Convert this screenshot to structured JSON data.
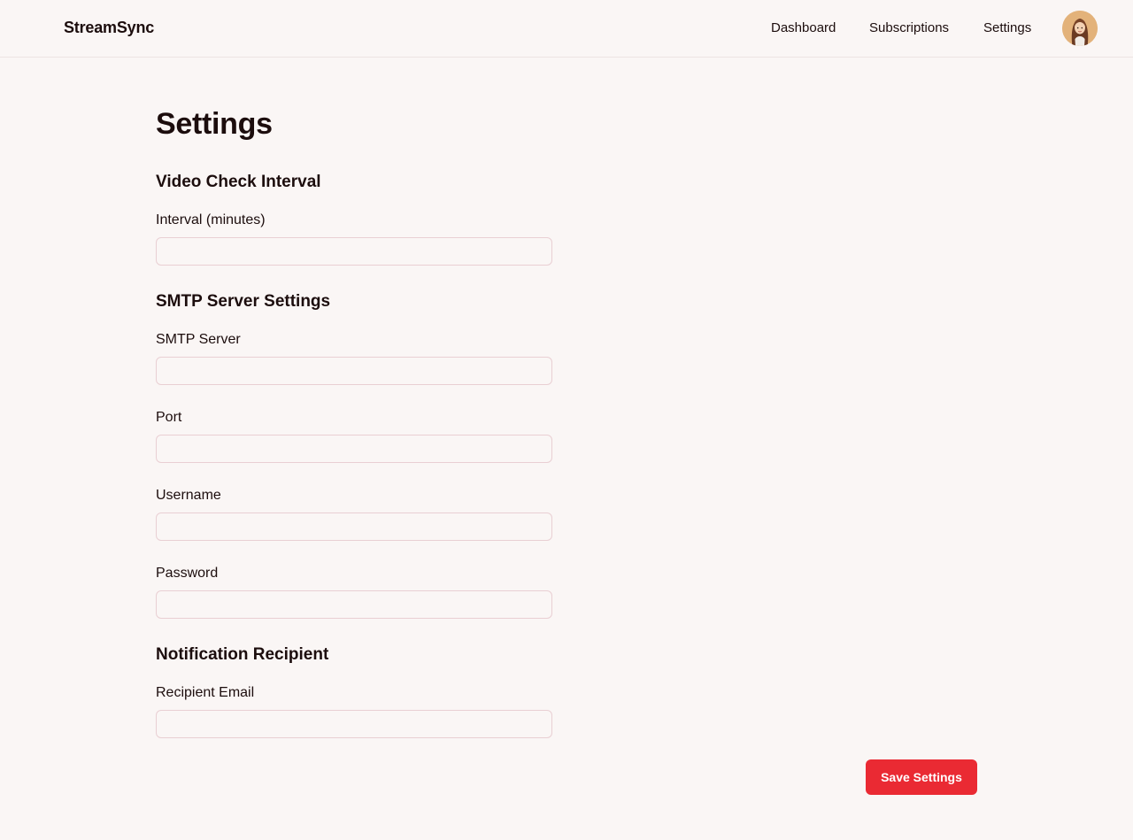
{
  "app": {
    "brand": "StreamSync"
  },
  "nav": {
    "items": [
      {
        "label": "Dashboard"
      },
      {
        "label": "Subscriptions"
      },
      {
        "label": "Settings"
      }
    ],
    "avatar_icon": "user-avatar-icon"
  },
  "page": {
    "title": "Settings"
  },
  "sections": {
    "video_check": {
      "title": "Video Check Interval",
      "interval_label": "Interval (minutes)",
      "interval_value": "",
      "interval_placeholder": ""
    },
    "smtp": {
      "title": "SMTP Server Settings",
      "server_label": "SMTP Server",
      "server_value": "",
      "port_label": "Port",
      "port_value": "",
      "username_label": "Username",
      "username_value": "",
      "password_label": "Password",
      "password_value": ""
    },
    "notification": {
      "title": "Notification Recipient",
      "email_label": "Recipient Email",
      "email_value": ""
    }
  },
  "actions": {
    "save_label": "Save Settings"
  },
  "colors": {
    "background": "#faf6f5",
    "text": "#1c0d0d",
    "input_border": "#e9cfd3",
    "primary_button": "#ea2a33",
    "avatar_bg": "#e3b27a"
  }
}
